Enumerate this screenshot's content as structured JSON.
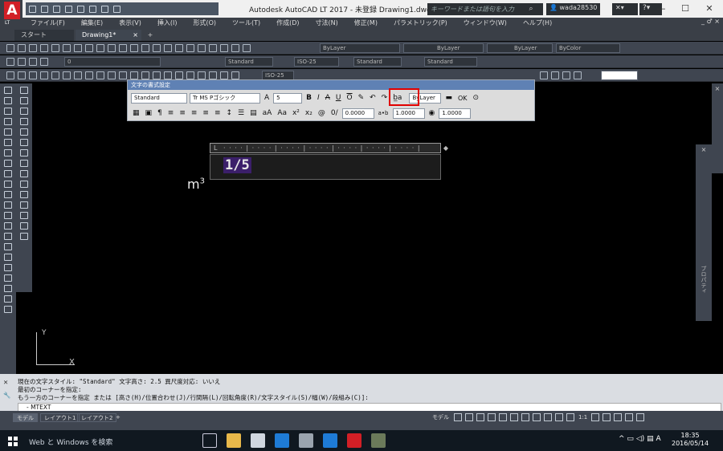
{
  "titlebar": {
    "app_logo": "A",
    "app_logo_sub": "LT",
    "app_title": "Autodesk AutoCAD LT 2017 - 未登録    Drawing1.dwg",
    "search_placeholder": "キーワードまたは語句を入力",
    "user_name": "wada28530",
    "help_label": "?",
    "minimize": "—",
    "maximize": "☐",
    "close": "✕"
  },
  "menu": {
    "items": [
      "ファイル(F)",
      "編集(E)",
      "表示(V)",
      "挿入(I)",
      "形式(O)",
      "ツール(T)",
      "作成(D)",
      "寸法(N)",
      "修正(M)",
      "パラメトリック(P)",
      "ウィンドウ(W)",
      "ヘルプ(H)"
    ],
    "right": "_ ♂ ×"
  },
  "tabs": {
    "start": "スタート",
    "drawing": "Drawing1*",
    "close": "×",
    "plus": "+"
  },
  "toolbar1": {
    "layer_color": "ByLayer",
    "linetype": "ByLayer",
    "lineweight": "ByLayer",
    "plotstyle": "ByColor"
  },
  "toolbar2": {
    "layer_value": "0",
    "text_style": "Standard",
    "dim_style": "ISO-25",
    "table_style": "Standard",
    "multileader_style": "Standard"
  },
  "toolbar3": {
    "dim_style": "ISO-25"
  },
  "text_format": {
    "title": "文字の書式設定",
    "style": "Standard",
    "font": "Tr MS Pゴシック",
    "height": "5",
    "bold": "B",
    "italic": "I",
    "strike": "A",
    "underline": "U",
    "overline": "O",
    "color": "ByLayer",
    "ok": "OK",
    "oblique": "0.0000",
    "tracking": "1.0000",
    "width": "1.0000",
    "tracking_label": "a•b",
    "oblique_label": "0/"
  },
  "editor": {
    "text": "1/5"
  },
  "canvas": {
    "label": "m",
    "label_sup": "3",
    "ucs_x": "X",
    "ucs_y": "Y"
  },
  "command": {
    "line1": "現在の文字スタイル:  \"Standard\"  文字高さ:  2.5  異尺度対応:  いいえ",
    "line2": "最初のコーナーを指定:",
    "line3": "もう一方のコーナーを指定 または [高さ(H)/位置合わせ(J)/行間隔(L)/回転角度(R)/文字スタイル(S)/幅(W)/段組み(C)]:",
    "input": "- MTEXT"
  },
  "status": {
    "model": "モデル",
    "layout1": "レイアウト1",
    "layout2": "レイアウト2",
    "plus": "+",
    "model_right": "モデル",
    "scale": "1:1"
  },
  "right_panel": {
    "label": "プロパティ"
  },
  "taskbar": {
    "search": "Web と Windows を検索",
    "time": "18:35",
    "date": "2016/05/14",
    "ime": "A"
  }
}
